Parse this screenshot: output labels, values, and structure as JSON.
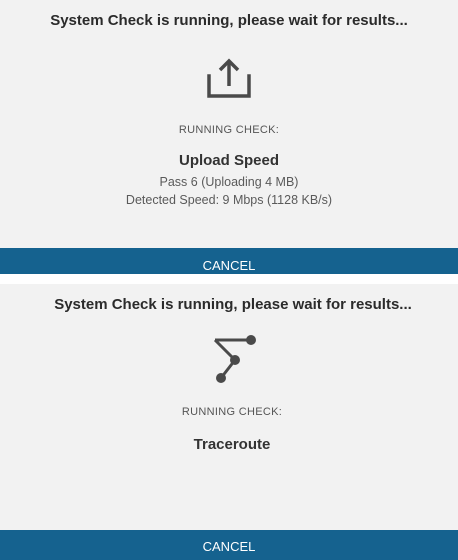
{
  "panels": [
    {
      "title": "System Check is running, please wait for results...",
      "icon": "upload-icon",
      "running_label": "RUNNING CHECK:",
      "check_name": "Upload Speed",
      "details": [
        "Pass 6 (Uploading 4 MB)",
        "Detected Speed: 9 Mbps (1128 KB/s)"
      ],
      "cancel_label": "CANCEL"
    },
    {
      "title": "System Check is running, please wait for results...",
      "icon": "traceroute-icon",
      "running_label": "RUNNING CHECK:",
      "check_name": "Traceroute",
      "cancel_label": "CANCEL"
    }
  ],
  "colors": {
    "panel_bg": "#f2f2f2",
    "button_bg": "#15628f",
    "icon": "#4a4a4a"
  }
}
